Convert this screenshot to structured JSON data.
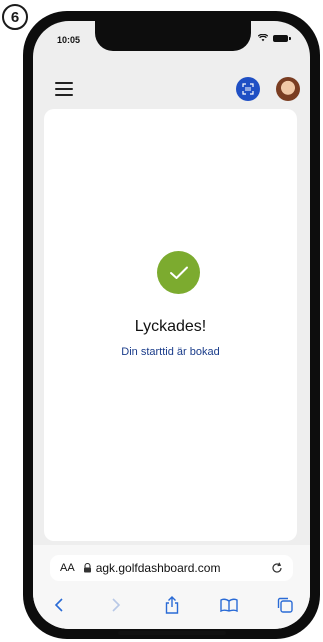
{
  "step": {
    "number": "6"
  },
  "status_bar": {
    "time": "10:05"
  },
  "result": {
    "title": "Lyckades!",
    "subtitle": "Din starttid är bokad"
  },
  "browser": {
    "text_size_label": "AA",
    "url": "agk.golfdashboard.com"
  },
  "colors": {
    "success": "#7cab2f",
    "accent": "#1f4fc4",
    "link": "#1a3c8a"
  },
  "icons": {
    "hamburger": "menu-icon",
    "scan": "scan-icon",
    "check": "check-icon",
    "lock": "lock-icon",
    "reload": "reload-icon",
    "back": "chevron-left-icon",
    "forward": "chevron-right-icon",
    "share": "share-icon",
    "bookmarks": "book-icon",
    "tabs": "tabs-icon"
  }
}
